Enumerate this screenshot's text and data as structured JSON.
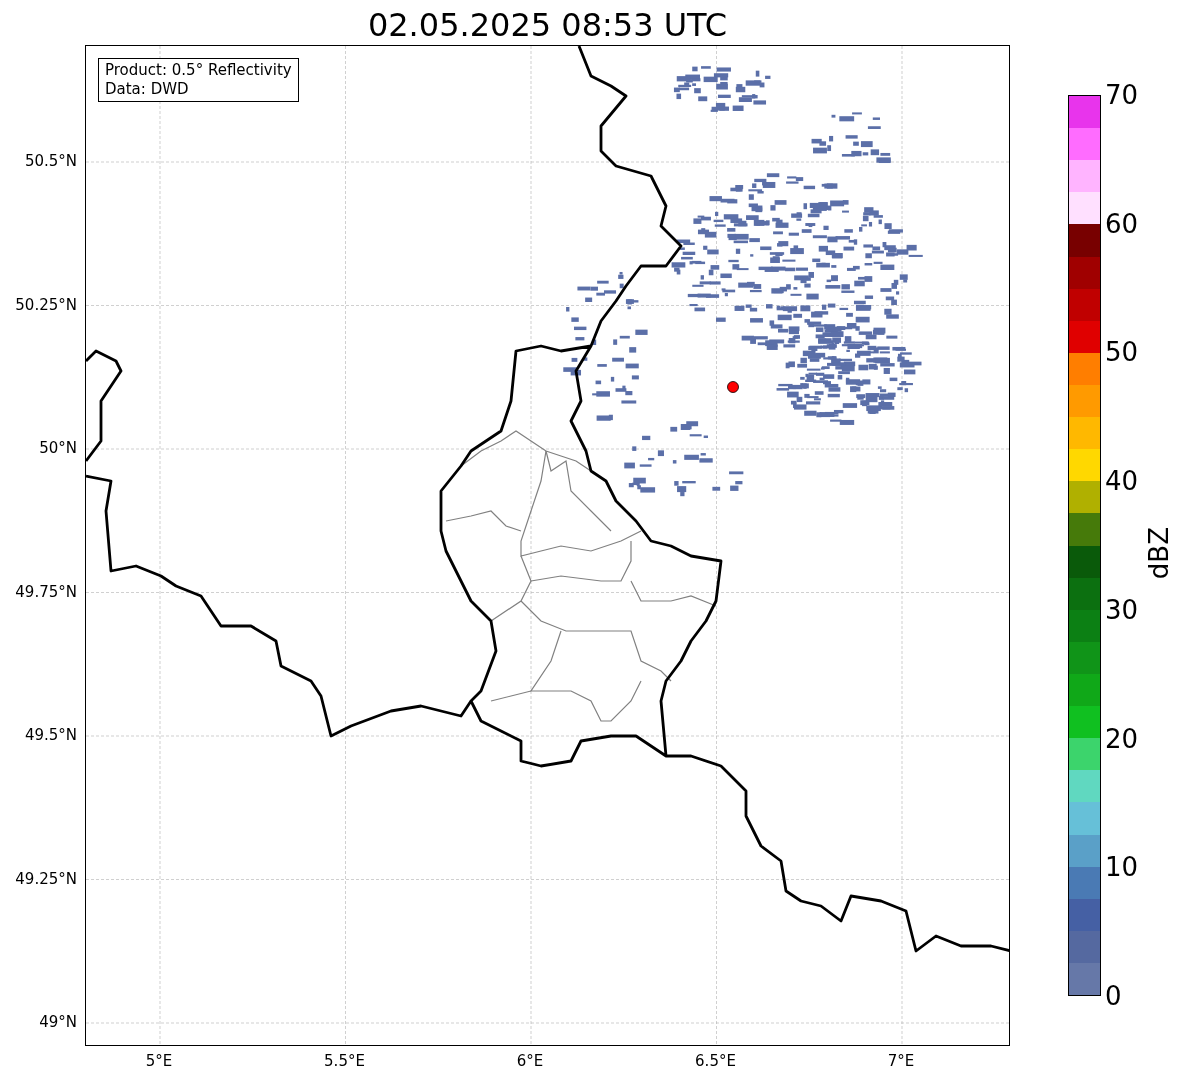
{
  "title": "02.05.2025 08:53 UTC",
  "info_box": {
    "lines": [
      "Product: 0.5° Reflectivity",
      "Data: DWD"
    ]
  },
  "map": {
    "lon_labels": [
      "5°E",
      "5.5°E",
      "6°E",
      "6.5°E",
      "7°E"
    ],
    "lat_labels": [
      "50.5°N",
      "50.25°N",
      "50°N",
      "49.75°N",
      "49.5°N",
      "49.25°N",
      "49°N"
    ]
  },
  "colorbar": {
    "label": "dBZ",
    "ticks": [
      "70",
      "60",
      "50",
      "40",
      "30",
      "20",
      "10",
      "0"
    ],
    "segments": [
      {
        "color": "#e834ec"
      },
      {
        "color": "#ff6cff"
      },
      {
        "color": "#ffb4ff"
      },
      {
        "color": "#ffe0ff"
      },
      {
        "color": "#780000"
      },
      {
        "color": "#a00000"
      },
      {
        "color": "#c00000"
      },
      {
        "color": "#e00000"
      },
      {
        "color": "#ff7e00"
      },
      {
        "color": "#ff9a00"
      },
      {
        "color": "#ffb800"
      },
      {
        "color": "#ffd800"
      },
      {
        "color": "#b0b000"
      },
      {
        "color": "#467a0a"
      },
      {
        "color": "#0a5a0a"
      },
      {
        "color": "#0c7010"
      },
      {
        "color": "#0c8014"
      },
      {
        "color": "#109418"
      },
      {
        "color": "#10a818"
      },
      {
        "color": "#10c020"
      },
      {
        "color": "#3cd46c"
      },
      {
        "color": "#60d8c0"
      },
      {
        "color": "#66c0d8"
      },
      {
        "color": "#5aa0c8"
      },
      {
        "color": "#4a7ab4"
      },
      {
        "color": "#4560a4"
      },
      {
        "color": "#5569a0"
      },
      {
        "color": "#6678a8"
      }
    ]
  }
}
